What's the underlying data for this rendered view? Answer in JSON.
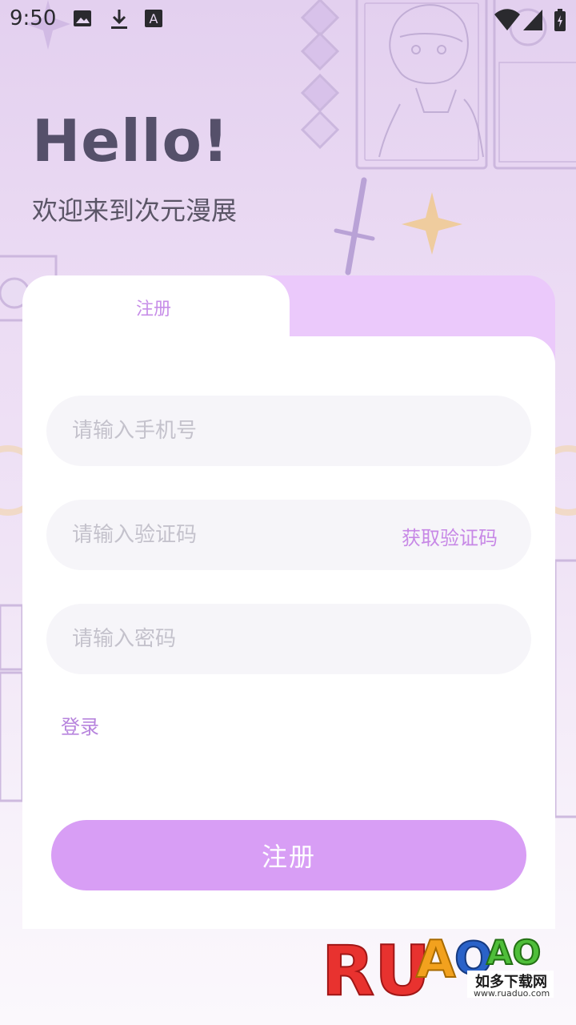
{
  "status_bar": {
    "time": "9:50",
    "icons_left": [
      "image-icon",
      "download-icon",
      "font-icon"
    ],
    "icons_right": [
      "wifi-icon",
      "signal-icon",
      "battery-icon"
    ]
  },
  "header": {
    "greeting": "Hello!",
    "welcome": "欢迎来到次元漫展"
  },
  "tabs": [
    {
      "label": "注册",
      "active": true
    }
  ],
  "form": {
    "phone_placeholder": "请输入手机号",
    "code_placeholder": "请输入验证码",
    "get_code_label": "获取验证码",
    "password_placeholder": "请输入密码",
    "login_link": "登录",
    "submit_label": "注册"
  },
  "watermark": {
    "brand": "RUANAO",
    "tagline": "如多下载网",
    "url": "www.ruaduo.com"
  },
  "colors": {
    "accent": "#d89ef5",
    "tab_inactive": "#ebc9fb",
    "link": "#c788e6",
    "field_bg": "#f6f5f9"
  }
}
